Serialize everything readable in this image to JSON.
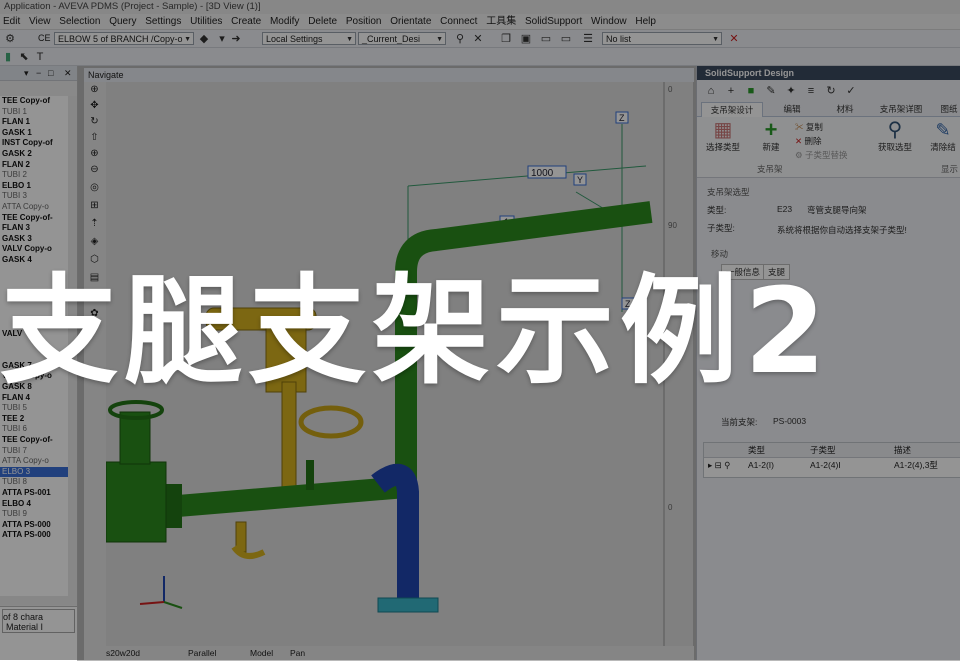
{
  "window": {
    "title": "Application - AVEVA PDMS (Project - Sample) - [3D View (1)]"
  },
  "menu": [
    "Edit",
    "View",
    "Selection",
    "Query",
    "Settings",
    "Utilities",
    "Create",
    "Modify",
    "Delete",
    "Position",
    "Orientate",
    "Connect",
    "工具集",
    "SolidSupport",
    "Window",
    "Help"
  ],
  "toolbar": {
    "ce_label": "CE",
    "ce_value": "ELBOW 5 of BRANCH /Copy-o",
    "settings_value": "Local Settings",
    "design_value": "_Current_Desi",
    "list_value": "No list"
  },
  "tree": {
    "items": [
      {
        "label": "TEE Copy-of",
        "style": "b"
      },
      {
        "label": "TUBI 1",
        "style": "l"
      },
      {
        "label": "FLAN 1",
        "style": "b"
      },
      {
        "label": "GASK 1",
        "style": "b"
      },
      {
        "label": "INST Copy-of",
        "style": "b"
      },
      {
        "label": "GASK 2",
        "style": "b"
      },
      {
        "label": "FLAN 2",
        "style": "b"
      },
      {
        "label": "TUBI 2",
        "style": "l"
      },
      {
        "label": "ELBO 1",
        "style": "b"
      },
      {
        "label": "TUBI 3",
        "style": "l"
      },
      {
        "label": "ATTA Copy-o",
        "style": "l"
      },
      {
        "label": "TEE Copy-of-",
        "style": "b"
      },
      {
        "label": "FLAN 3",
        "style": "b"
      },
      {
        "label": "GASK 3",
        "style": "b"
      },
      {
        "label": "VALV Copy-o",
        "style": "b"
      },
      {
        "label": "GASK 4",
        "style": "b"
      },
      {
        "label": "",
        "style": "l"
      },
      {
        "label": "",
        "style": "l"
      },
      {
        "label": "",
        "style": "l"
      },
      {
        "label": "",
        "style": "l"
      },
      {
        "label": "",
        "style": "l"
      },
      {
        "label": "",
        "style": "l"
      },
      {
        "label": "VALV",
        "style": "b"
      },
      {
        "label": "",
        "style": "l"
      },
      {
        "label": "",
        "style": "l"
      },
      {
        "label": "GASK 7",
        "style": "b"
      },
      {
        "label": "VALV Copy-o",
        "style": "b"
      },
      {
        "label": "GASK 8",
        "style": "b"
      },
      {
        "label": "FLAN 4",
        "style": "b"
      },
      {
        "label": "TUBI 5",
        "style": "l"
      },
      {
        "label": "TEE 2",
        "style": "b"
      },
      {
        "label": "TUBI 6",
        "style": "l"
      },
      {
        "label": "TEE Copy-of-",
        "style": "b"
      },
      {
        "label": "TUBI 7",
        "style": "l"
      },
      {
        "label": "ATTA Copy-o",
        "style": "l"
      },
      {
        "label": "ELBO 3",
        "style": "sel"
      },
      {
        "label": "TUBI 8",
        "style": "l"
      },
      {
        "label": "ATTA PS-001",
        "style": "b"
      },
      {
        "label": "ELBO 4",
        "style": "b"
      },
      {
        "label": "TUBI 9",
        "style": "l"
      },
      {
        "label": "ATTA PS-000",
        "style": "b"
      },
      {
        "label": "ATTA PS-000",
        "style": "b"
      }
    ]
  },
  "properties": {
    "line1": "of 8 chara",
    "line2": "Material I"
  },
  "view": {
    "header": "Navigate",
    "dimension_label": "1000",
    "axis_z": "Z",
    "axis_y": "Y",
    "tag_top": "1",
    "tag_mid": "Z",
    "scale_top": "0",
    "scale_mid": "90",
    "scale_bot": "0",
    "status": {
      "size": "s20w20d",
      "projection": "Parallel",
      "mode": "Model",
      "action": "Pan"
    }
  },
  "right_panel": {
    "title": "SolidSupport Design",
    "tabs": [
      "支吊架设计",
      "编辑",
      "材料",
      "支吊架详图",
      "图纸"
    ],
    "ribbon": {
      "select_type": "选择类型",
      "add": "新建",
      "copy": "复制",
      "delete": "删除",
      "sub_type_replace": "子类型替换",
      "group_label": "支吊架",
      "get_selection": "获取选型",
      "clear": "清除结",
      "group2": "显示"
    },
    "section_label": "支吊架选型",
    "type_label": "类型:",
    "type_code": "E23",
    "type_desc": "弯管支腿导向架",
    "subtype_label": "子类型:",
    "subtype_desc": "系统将根据你自动选择支架子类型!",
    "move_label": "移动",
    "sub_tabs": [
      "一般信息",
      "支腿"
    ],
    "current_label": "当前支架:",
    "current_value": "PS-0003",
    "grid": {
      "headers": [
        "类型",
        "子类型",
        "描述"
      ],
      "row": [
        "A1-2(I)",
        "A1-2(4)I",
        "A1-2(4),3型"
      ]
    }
  },
  "banner": "支腿支架示例2",
  "colors": {
    "pipe_green": "#2c8a1e",
    "pipe_blue": "#1f45b0",
    "valve_yellow": "#d6b21f",
    "support_cyan": "#39b6c8",
    "dim_line": "#3a9a6a"
  }
}
